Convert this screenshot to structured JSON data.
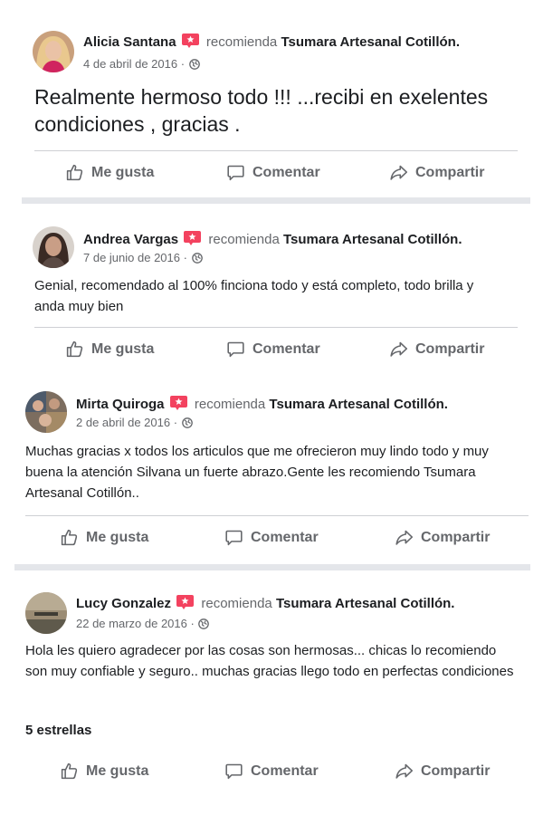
{
  "recommend_verb": "recomienda",
  "page_name": "Tsumara Artesanal Cotillón.",
  "actions": {
    "like": "Me gusta",
    "comment": "Comentar",
    "share": "Compartir"
  },
  "icons": {
    "like": "thumbs-up-icon",
    "comment": "comment-bubble-icon",
    "share": "share-arrow-icon",
    "badge": "recommendation-badge-icon",
    "privacy": "globe-icon"
  },
  "colors": {
    "badge": "#f3425f",
    "text_secondary": "#65676b",
    "separator": "#e4e6ea"
  },
  "posts": [
    {
      "author": "Alicia Santana",
      "date": "4 de abril de 2016 ·",
      "text": "Realmente hermoso todo !!! ...recibi en exelentes condiciones , gracias ."
    },
    {
      "author": "Andrea Vargas",
      "date": "7 de junio de 2016 ·",
      "text": "Genial, recomendado al 100% finciona todo y está completo, todo brilla y anda muy bien"
    },
    {
      "author": "Mirta Quiroga",
      "date": "2 de abril de 2016 ·",
      "text": "Muchas gracias x todos los articulos que me ofrecieron muy lindo todo y muy buena la atención Silvana un fuerte abrazo.Gente les recomiendo Tsumara Artesanal Cotillón.."
    },
    {
      "author": "Lucy Gonzalez",
      "date": "22 de marzo de 2016 ·",
      "text": "Hola les quiero agradecer por las cosas son hermosas...  chicas lo recomiendo son muy confiable y seguro..  muchas gracias llego todo en perfectas condiciones",
      "rating": "5 estrellas"
    }
  ]
}
